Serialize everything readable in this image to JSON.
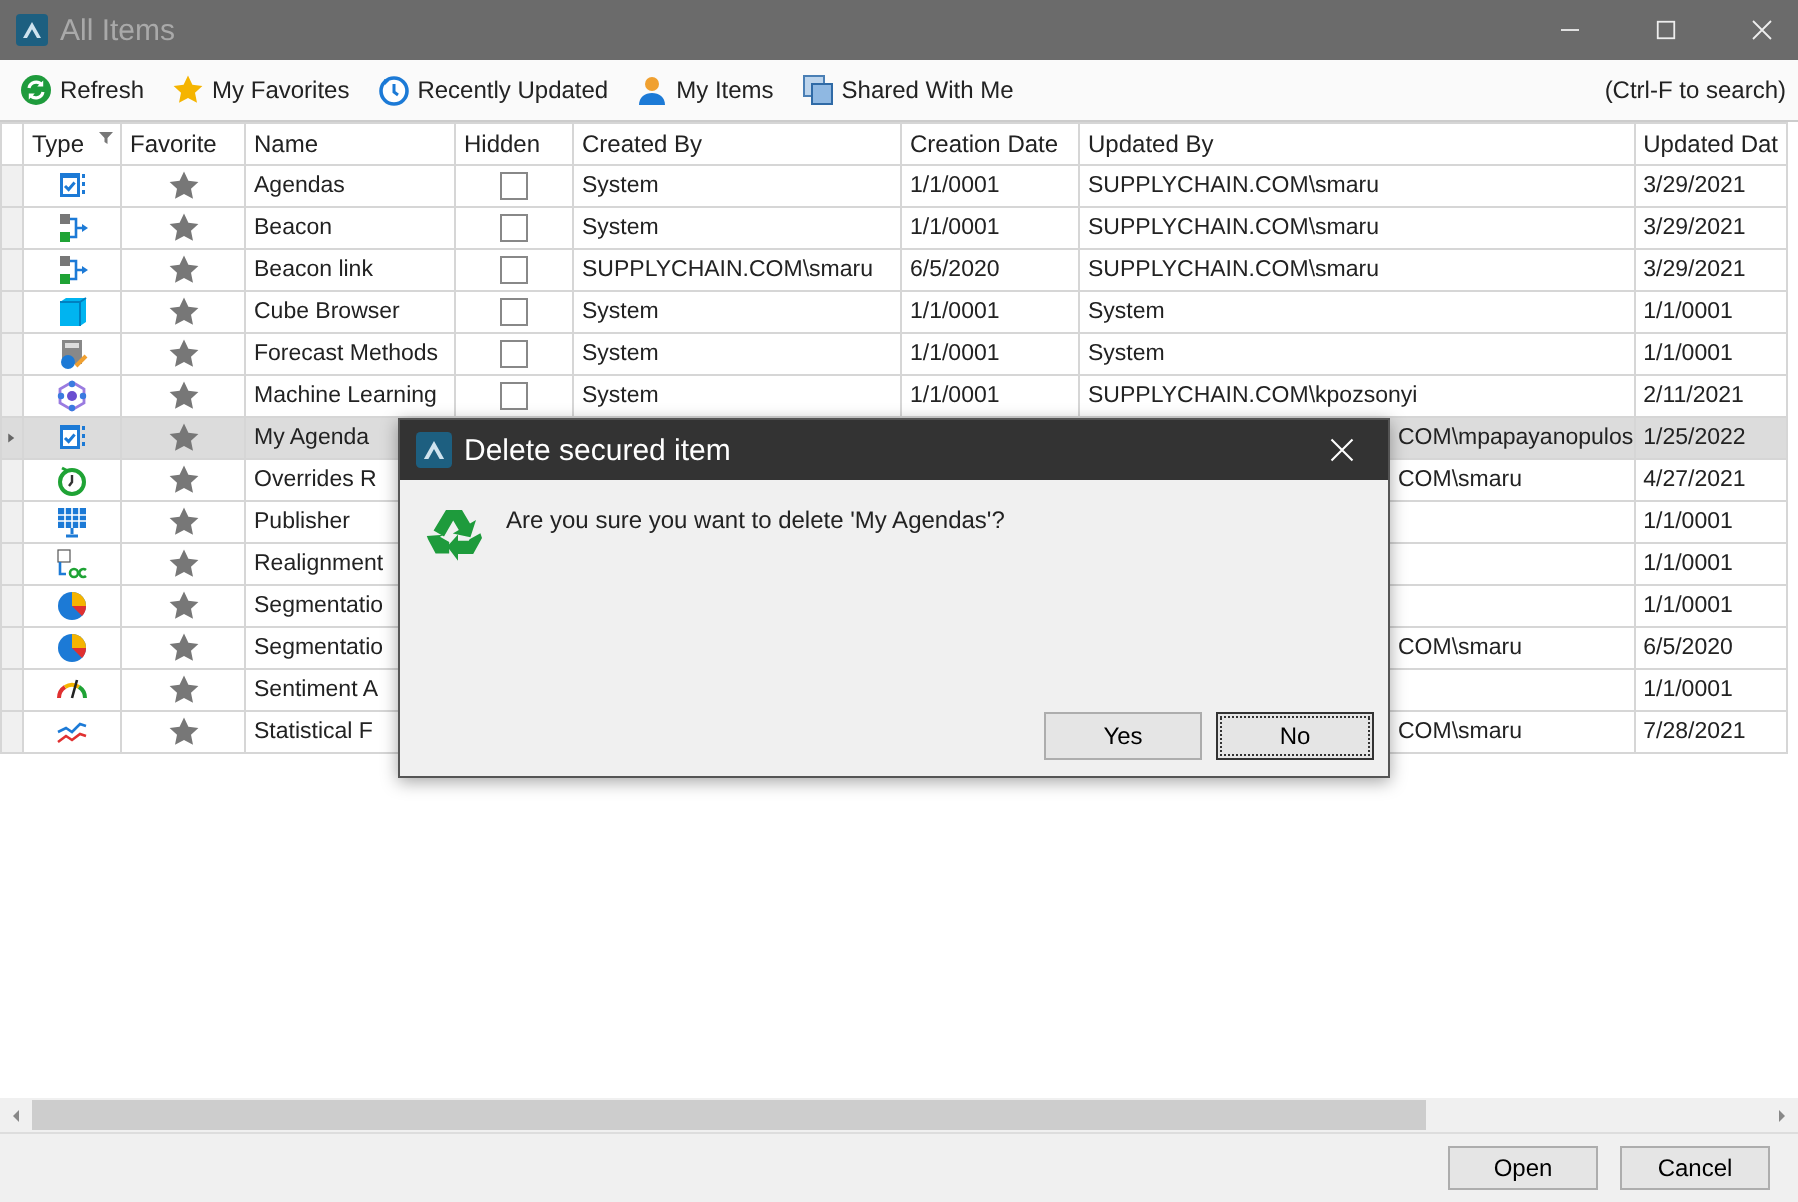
{
  "window": {
    "title": "All Items"
  },
  "toolbar": {
    "items": [
      {
        "kind": "refresh",
        "label": "Refresh"
      },
      {
        "kind": "favorites",
        "label": "My Favorites"
      },
      {
        "kind": "recent",
        "label": "Recently Updated"
      },
      {
        "kind": "person",
        "label": "My Items"
      },
      {
        "kind": "shared",
        "label": "Shared With Me"
      }
    ],
    "hint": "(Ctrl-F to search)"
  },
  "table": {
    "columns": [
      "Type",
      "Favorite",
      "Name",
      "Hidden",
      "Created By",
      "Creation Date",
      "Updated By",
      "Updated Dat"
    ],
    "rows": [
      {
        "kind": "agenda",
        "selected": false,
        "favorite": false,
        "name": "Agendas",
        "hidden": false,
        "created_by": "System",
        "creation_date": "1/1/0001",
        "updated_by": "SUPPLYCHAIN.COM\\smaru",
        "updated_date": "3/29/2021"
      },
      {
        "kind": "flow",
        "selected": false,
        "favorite": false,
        "name": "Beacon",
        "hidden": false,
        "created_by": "System",
        "creation_date": "1/1/0001",
        "updated_by": "SUPPLYCHAIN.COM\\smaru",
        "updated_date": "3/29/2021"
      },
      {
        "kind": "flow",
        "selected": false,
        "favorite": false,
        "name": "Beacon link",
        "hidden": false,
        "created_by": "SUPPLYCHAIN.COM\\smaru",
        "creation_date": "6/5/2020",
        "updated_by": "SUPPLYCHAIN.COM\\smaru",
        "updated_date": "3/29/2021"
      },
      {
        "kind": "cube",
        "selected": false,
        "favorite": false,
        "name": "Cube Browser",
        "hidden": false,
        "created_by": "System",
        "creation_date": "1/1/0001",
        "updated_by": "System",
        "updated_date": "1/1/0001"
      },
      {
        "kind": "calculator",
        "selected": false,
        "favorite": false,
        "name": "Forecast Methods",
        "hidden": false,
        "created_by": "System",
        "creation_date": "1/1/0001",
        "updated_by": "System",
        "updated_date": "1/1/0001"
      },
      {
        "kind": "network",
        "selected": false,
        "favorite": false,
        "name": "Machine Learning",
        "hidden": false,
        "created_by": "System",
        "creation_date": "1/1/0001",
        "updated_by": "SUPPLYCHAIN.COM\\kpozsonyi",
        "updated_date": "2/11/2021"
      },
      {
        "kind": "agenda",
        "selected": true,
        "favorite": false,
        "name": "My Agenda",
        "updated_by_tail": "COM\\mpapayanopulos",
        "updated_date": "1/25/2022"
      },
      {
        "kind": "timer",
        "selected": false,
        "favorite": false,
        "name": "Overrides R",
        "updated_by_tail": "COM\\smaru",
        "updated_date": "4/27/2021"
      },
      {
        "kind": "board",
        "selected": false,
        "favorite": false,
        "name": "Publisher",
        "updated_date": "1/1/0001"
      },
      {
        "kind": "text",
        "selected": false,
        "favorite": false,
        "name": "Realignment",
        "updated_date": "1/1/0001"
      },
      {
        "kind": "pie",
        "selected": false,
        "favorite": false,
        "name": "Segmentatio",
        "updated_date": "1/1/0001"
      },
      {
        "kind": "pie",
        "selected": false,
        "favorite": false,
        "name": "Segmentatio",
        "updated_by_tail": "COM\\smaru",
        "updated_date": "6/5/2020"
      },
      {
        "kind": "gauge",
        "selected": false,
        "favorite": false,
        "name": "Sentiment A",
        "updated_date": "1/1/0001"
      },
      {
        "kind": "linechart",
        "selected": false,
        "favorite": false,
        "name": "Statistical F",
        "updated_by_tail": "COM\\smaru",
        "updated_date": "7/28/2021"
      }
    ]
  },
  "footer": {
    "buttons": [
      "Open",
      "Cancel"
    ]
  },
  "dialog": {
    "title": "Delete secured item",
    "message": "Are you sure you want to delete 'My Agendas'?",
    "buttons": [
      {
        "label": "Yes",
        "focused": false
      },
      {
        "label": "No",
        "focused": true
      }
    ]
  }
}
